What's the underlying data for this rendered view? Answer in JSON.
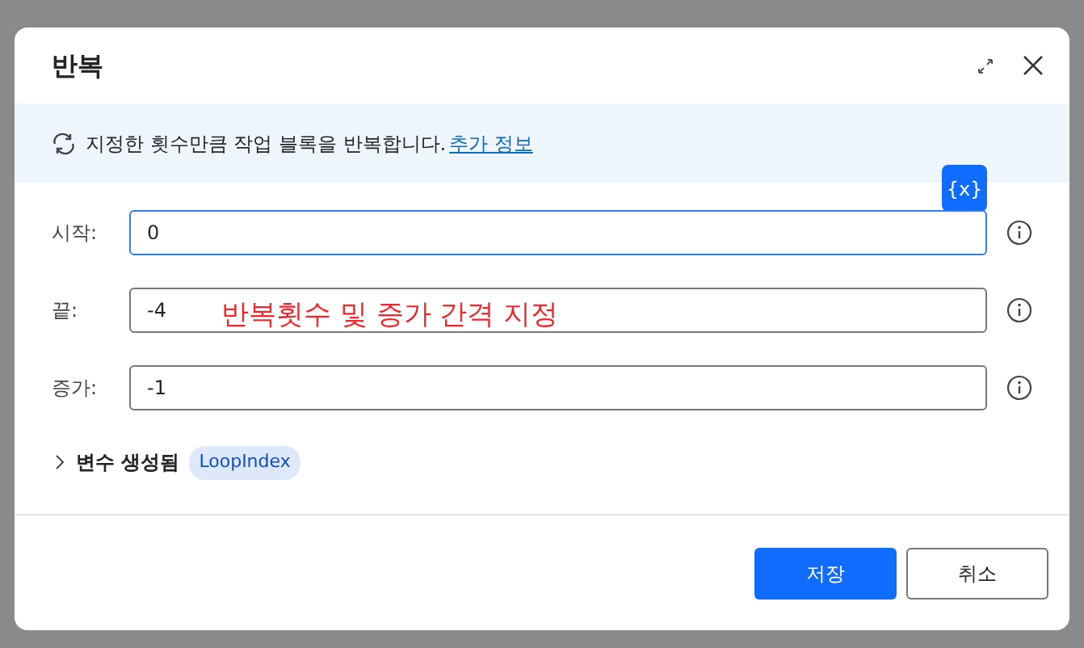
{
  "dialog": {
    "title": "반복"
  },
  "banner": {
    "text": "지정한 횟수만큼 작업 블록을 반복합니다.",
    "link": "추가 정보"
  },
  "variable_button": {
    "label": "{x}"
  },
  "fields": [
    {
      "label": "시작:",
      "value": "0",
      "focused": true
    },
    {
      "label": "끝:",
      "value": "-4",
      "focused": false
    },
    {
      "label": "증가:",
      "value": "-1",
      "focused": false
    }
  ],
  "annotation": {
    "text": "반복횟수 및 증가 간격 지정"
  },
  "variables": {
    "label": "변수 생성됨",
    "expanded": false,
    "chips": [
      "LoopIndex"
    ]
  },
  "buttons": [
    {
      "label": "저장",
      "kind": "primary"
    },
    {
      "label": "취소",
      "kind": "secondary"
    }
  ]
}
